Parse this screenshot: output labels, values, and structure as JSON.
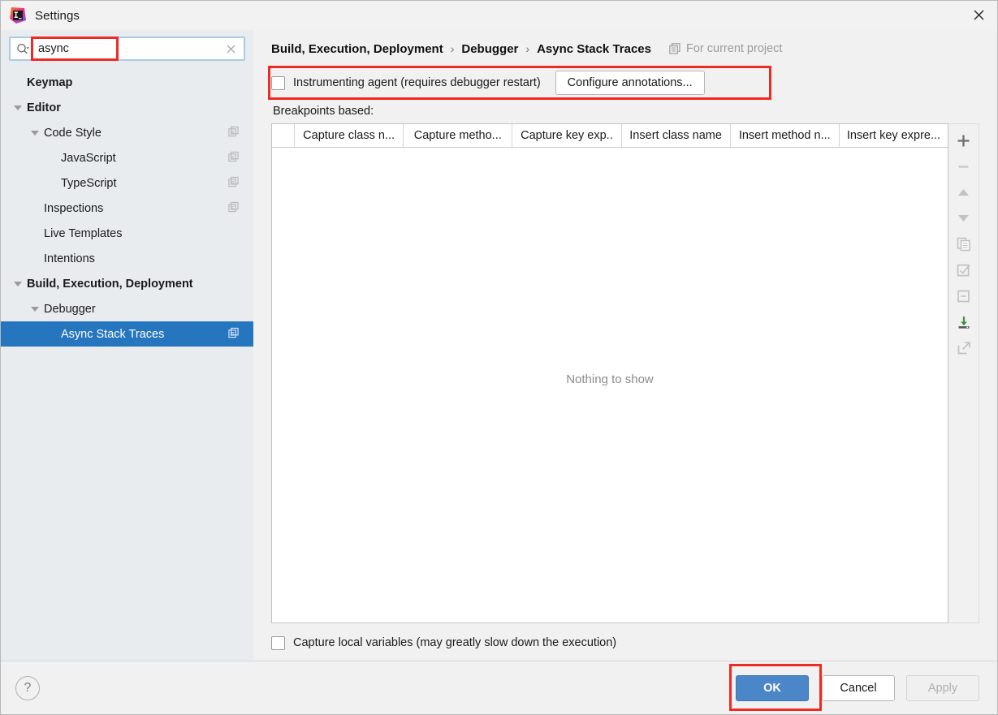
{
  "window": {
    "title": "Settings",
    "logo_icon": "intellij-idea-logo",
    "close_icon": "close-icon"
  },
  "search": {
    "value": "async",
    "icon": "search-icon",
    "clear_icon": "clear-icon",
    "highlight_color": "#ee2b22"
  },
  "sidebar": {
    "background": "#e8ecef",
    "selection_color": "#2675bf",
    "items": [
      {
        "label": "Keymap",
        "indent": 0,
        "bold": true,
        "twisty": "none",
        "badge": false,
        "selected": false
      },
      {
        "label": "Editor",
        "indent": 0,
        "bold": true,
        "twisty": "expanded",
        "badge": false,
        "selected": false
      },
      {
        "label": "Code Style",
        "indent": 1,
        "bold": false,
        "twisty": "expanded",
        "badge": true,
        "selected": false
      },
      {
        "label": "JavaScript",
        "indent": 2,
        "bold": false,
        "twisty": "none",
        "badge": true,
        "selected": false
      },
      {
        "label": "TypeScript",
        "indent": 2,
        "bold": false,
        "twisty": "none",
        "badge": true,
        "selected": false
      },
      {
        "label": "Inspections",
        "indent": 1,
        "bold": false,
        "twisty": "none",
        "badge": true,
        "selected": false
      },
      {
        "label": "Live Templates",
        "indent": 1,
        "bold": false,
        "twisty": "none",
        "badge": false,
        "selected": false
      },
      {
        "label": "Intentions",
        "indent": 1,
        "bold": false,
        "twisty": "none",
        "badge": false,
        "selected": false
      },
      {
        "label": "Build, Execution, Deployment",
        "indent": 0,
        "bold": true,
        "twisty": "expanded",
        "badge": false,
        "selected": false
      },
      {
        "label": "Debugger",
        "indent": 1,
        "bold": false,
        "twisty": "expanded",
        "badge": false,
        "selected": false
      },
      {
        "label": "Async Stack Traces",
        "indent": 2,
        "bold": false,
        "twisty": "none",
        "badge": true,
        "selected": true
      }
    ]
  },
  "breadcrumb": {
    "parts": [
      "Build, Execution, Deployment",
      "Debugger",
      "Async Stack Traces"
    ],
    "separator": "›",
    "scope_label": "For current project",
    "scope_icon": "project-scope-icon"
  },
  "agent": {
    "checkbox_label": "Instrumenting agent (requires debugger restart)",
    "checked": false,
    "configure_button": "Configure annotations...",
    "highlight_color": "#ee2b22"
  },
  "table": {
    "caption": "Breakpoints based:",
    "columns": [
      "Capture class n...",
      "Capture metho...",
      "Capture key exp..",
      "Insert class name",
      "Insert method n...",
      "Insert key expre..."
    ],
    "rows": [],
    "empty_text": "Nothing to show",
    "toolbar": [
      {
        "name": "add-icon",
        "glyph": "+"
      },
      {
        "name": "remove-icon",
        "glyph": "−"
      },
      {
        "name": "move-up-icon",
        "glyph": "▲"
      },
      {
        "name": "move-down-icon",
        "glyph": "▼"
      },
      {
        "name": "copy-icon",
        "glyph": "❐"
      },
      {
        "name": "enable-all-icon",
        "glyph": "☑"
      },
      {
        "name": "disable-all-icon",
        "glyph": "⊟"
      },
      {
        "name": "import-icon",
        "glyph": "↓"
      },
      {
        "name": "export-icon",
        "glyph": "↗"
      }
    ]
  },
  "capture_locals": {
    "label": "Capture local variables (may greatly slow down the execution)",
    "checked": false
  },
  "footer": {
    "help_icon": "help-icon",
    "help_glyph": "?",
    "ok": "OK",
    "cancel": "Cancel",
    "apply": "Apply",
    "ok_highlight_color": "#ee2b22",
    "ok_color": "#4a86c8"
  }
}
